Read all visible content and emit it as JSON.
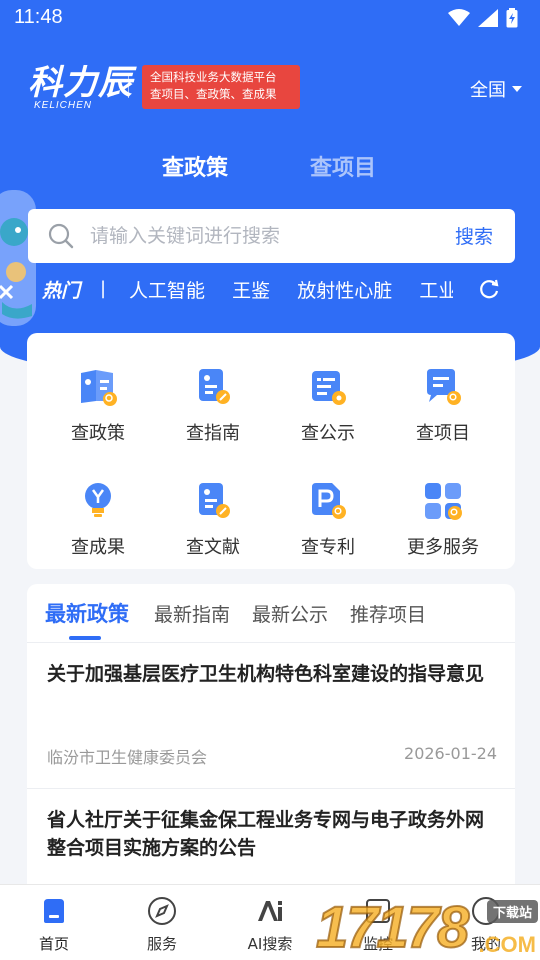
{
  "status_bar": {
    "time": "11:48"
  },
  "header": {
    "logo_text": "科力辰",
    "logo_subtext": "KELICHEN",
    "slogan_line1": "全国科技业务大数据平台",
    "slogan_line2": "查项目、查政策、查成果",
    "region": "全国"
  },
  "mode_tabs": [
    {
      "label": "查政策",
      "active": true
    },
    {
      "label": "查项目",
      "active": false
    }
  ],
  "search": {
    "placeholder": "请输入关键词进行搜索",
    "value": "",
    "button_label": "搜索"
  },
  "hot": {
    "label": "热门",
    "separator": "|",
    "keywords": [
      "人工智能",
      "王鉴",
      "放射性心脏",
      "工业"
    ]
  },
  "services": [
    {
      "label": "查政策",
      "icon": "policy-icon"
    },
    {
      "label": "查指南",
      "icon": "guide-icon"
    },
    {
      "label": "查公示",
      "icon": "announcement-icon"
    },
    {
      "label": "查项目",
      "icon": "project-icon"
    },
    {
      "label": "查成果",
      "icon": "achievement-icon"
    },
    {
      "label": "查文献",
      "icon": "literature-icon"
    },
    {
      "label": "查专利",
      "icon": "patent-icon"
    },
    {
      "label": "更多服务",
      "icon": "more-services-icon"
    }
  ],
  "news": {
    "tabs": [
      {
        "label": "最新政策",
        "active": true
      },
      {
        "label": "最新指南",
        "active": false
      },
      {
        "label": "最新公示",
        "active": false
      },
      {
        "label": "推荐项目",
        "active": false
      }
    ],
    "articles": [
      {
        "title": "关于加强基层医疗卫生机构特色科室建设的指导意见",
        "source": "临汾市卫生健康委员会",
        "date": "2026-01-24"
      },
      {
        "title": "省人社厅关于征集金保工程业务专网与电子政务外网整合项目实施方案的公告",
        "source": "",
        "date": ""
      }
    ]
  },
  "bottom_nav": [
    {
      "label": "首页",
      "icon": "home-icon",
      "active": true
    },
    {
      "label": "服务",
      "icon": "compass-icon",
      "active": false
    },
    {
      "label": "AI搜索",
      "icon": "ai-search-icon",
      "active": false
    },
    {
      "label": "监控",
      "icon": "monitor-icon",
      "active": false
    },
    {
      "label": "我的",
      "icon": "profile-icon",
      "active": false
    }
  ],
  "watermark": {
    "number": "17178",
    "badge": "下载站",
    "suffix": ".COM"
  },
  "colors": {
    "brand_blue": "#2f6df6",
    "slogan_red": "#e8463f",
    "icon_orange": "#ffb224"
  }
}
